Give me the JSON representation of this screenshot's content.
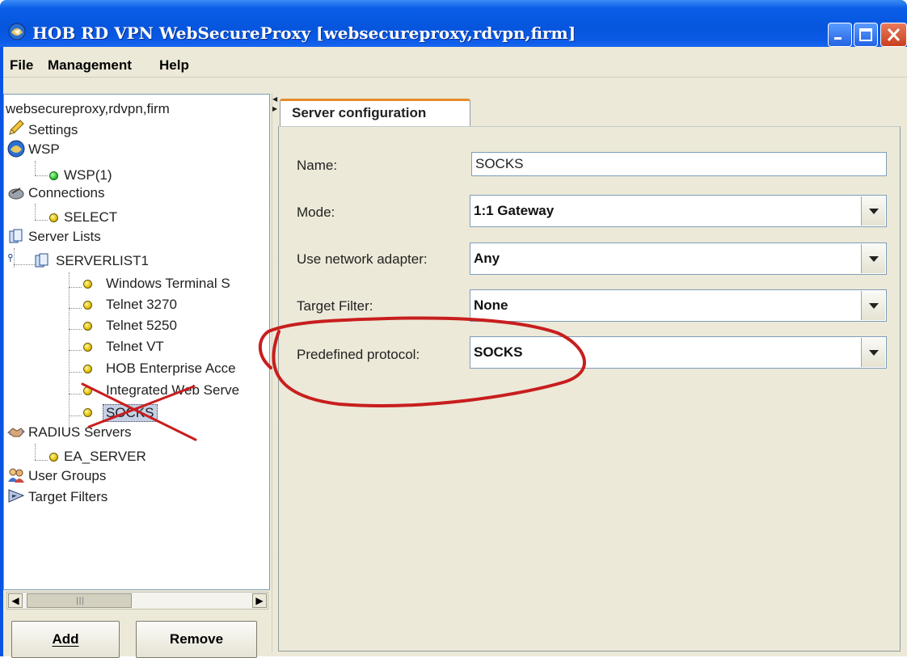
{
  "window": {
    "title": "HOB RD VPN WebSecureProxy [websecureproxy,rdvpn,firm]"
  },
  "menu": {
    "file": "File",
    "management": "Management",
    "help": "Help"
  },
  "tree": {
    "root": "websecureproxy,rdvpn,firm",
    "settings": "Settings",
    "wsp": "WSP",
    "wsp_child": "WSP(1)",
    "connections": "Connections",
    "connections_child": "SELECT",
    "server_lists": "Server Lists",
    "serverlist1": "SERVERLIST1",
    "servers": [
      "Windows Terminal S",
      "Telnet 3270",
      "Telnet 5250",
      "Telnet VT",
      "HOB Enterprise Acce",
      "Integrated Web Serve",
      "SOCKS"
    ],
    "radius_servers": "RADIUS Servers",
    "radius_child": "EA_SERVER",
    "user_groups": "User Groups",
    "target_filters": "Target Filters",
    "selected": "SOCKS"
  },
  "scrollbar": {
    "left_arrow": "◀",
    "right_arrow": "▶",
    "grip": "|||"
  },
  "buttons": {
    "add": "Add",
    "remove": "Remove"
  },
  "tab": {
    "label": "Server configuration"
  },
  "form": {
    "name_label": "Name:",
    "name_value": "SOCKS",
    "mode_label": "Mode:",
    "mode_value": "1:1 Gateway",
    "adapter_label": "Use network adapter:",
    "adapter_value": "Any",
    "filter_label": "Target Filter:",
    "filter_value": "None",
    "protocol_label": "Predefined protocol:",
    "protocol_value": "SOCKS"
  },
  "colors": {
    "title_bar": "#0b5ee8",
    "annotation": "#c81e1e",
    "tab_accent": "#e68b2c"
  }
}
